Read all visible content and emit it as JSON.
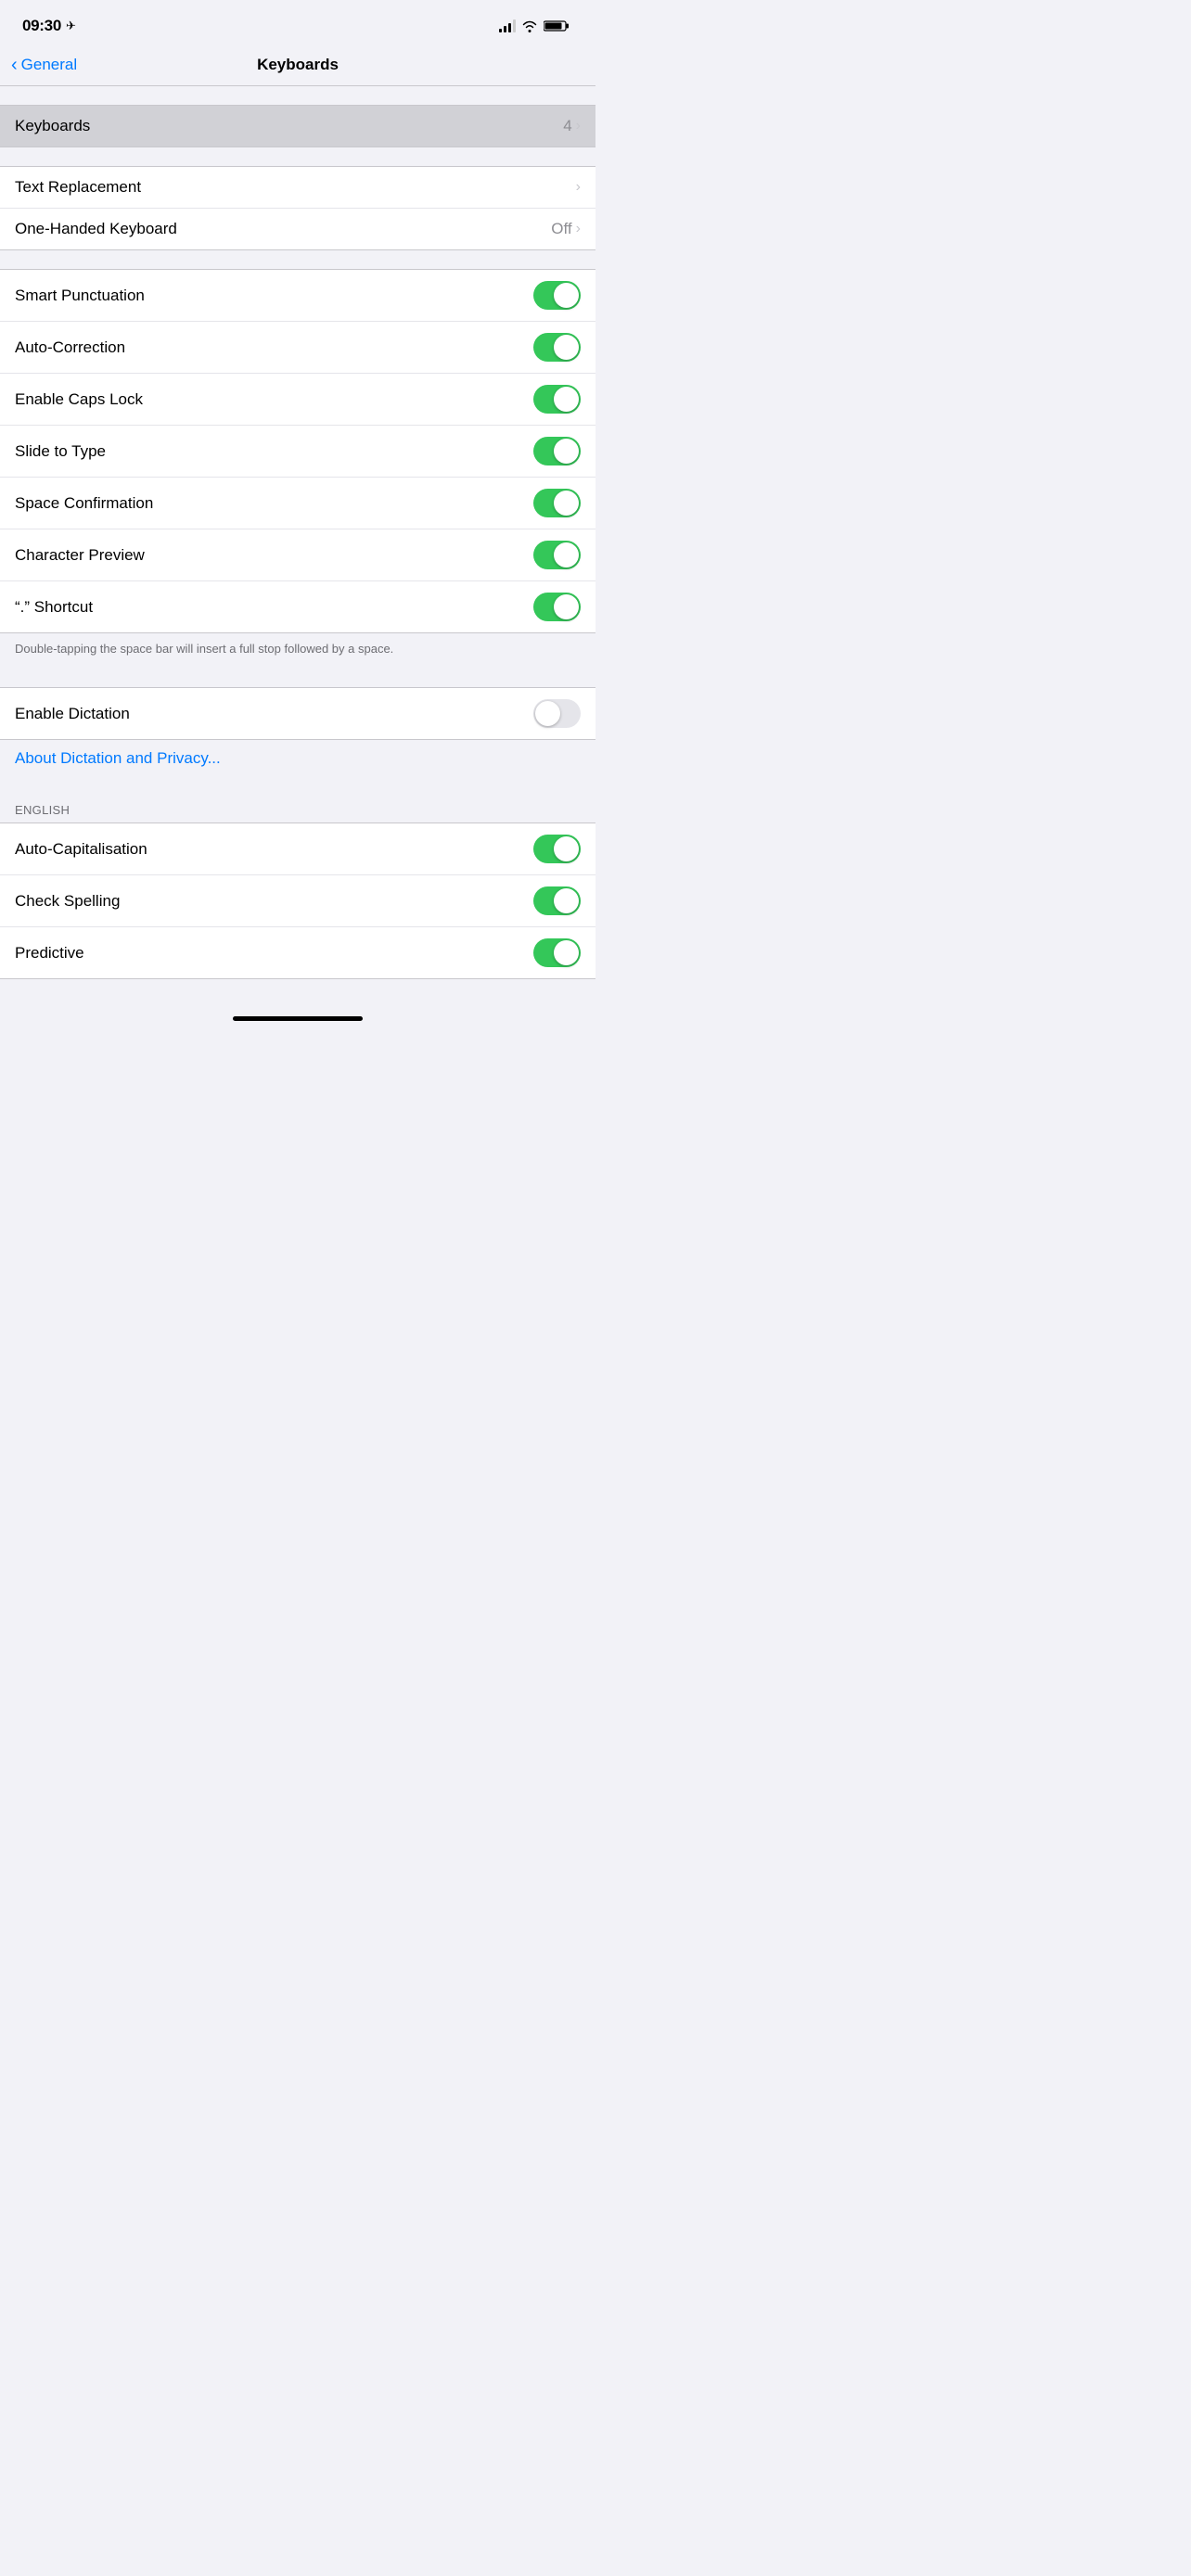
{
  "statusBar": {
    "time": "09:30",
    "locationIcon": "✈",
    "batteryLevel": 80
  },
  "header": {
    "backLabel": "General",
    "title": "Keyboards"
  },
  "sections": {
    "keyboards": {
      "items": [
        {
          "label": "Keyboards",
          "value": "4",
          "hasChevron": true,
          "highlighted": true
        }
      ]
    },
    "shortcuts": {
      "items": [
        {
          "label": "Text Replacement",
          "value": "",
          "hasChevron": true
        },
        {
          "label": "One-Handed Keyboard",
          "value": "Off",
          "hasChevron": true
        }
      ]
    },
    "toggles": {
      "items": [
        {
          "label": "Smart Punctuation",
          "toggle": true,
          "on": true
        },
        {
          "label": "Auto-Correction",
          "toggle": true,
          "on": true
        },
        {
          "label": "Enable Caps Lock",
          "toggle": true,
          "on": true
        },
        {
          "label": "Slide to Type",
          "toggle": true,
          "on": true
        },
        {
          "label": "Space Confirmation",
          "toggle": true,
          "on": true
        },
        {
          "label": "Character Preview",
          "toggle": true,
          "on": true
        },
        {
          "label": "“.” Shortcut",
          "toggle": true,
          "on": true
        }
      ],
      "footer": "Double-tapping the space bar will insert a full stop followed by a space."
    },
    "dictation": {
      "items": [
        {
          "label": "Enable Dictation",
          "toggle": true,
          "on": false
        }
      ],
      "linkText": "About Dictation and Privacy..."
    },
    "english": {
      "header": "ENGLISH",
      "items": [
        {
          "label": "Auto-Capitalisation",
          "toggle": true,
          "on": true
        },
        {
          "label": "Check Spelling",
          "toggle": true,
          "on": true
        },
        {
          "label": "Predictive",
          "toggle": true,
          "on": true
        }
      ]
    }
  }
}
